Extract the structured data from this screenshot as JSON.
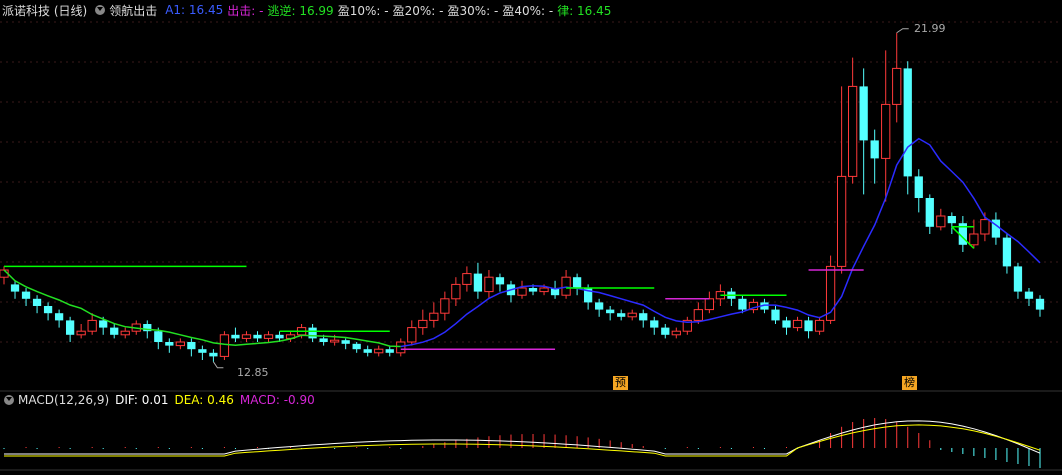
{
  "header": {
    "stock": "派诺科技 (日线)",
    "indicator": "领航出击",
    "a1": "A1: 16.45",
    "chuji": "出击: -",
    "taoni": "逃逆: 16.99",
    "y10": "盈10%: -",
    "y20": "盈20%: -",
    "y30": "盈30%: -",
    "y40": "盈40%: -",
    "lv": "律: 16.45"
  },
  "macd_header": {
    "name": "MACD(12,26,9)",
    "dif": "DIF: 0.01",
    "dea": "DEA: 0.46",
    "macd": "MACD: -0.90"
  },
  "price_labels": {
    "high": "21.99",
    "low": "12.85"
  },
  "tags": {
    "yu": "预",
    "bang": "榜"
  },
  "colors": {
    "up": "#ff3a3a",
    "down": "#54ffff",
    "bg": "#000000",
    "ma_green": "#22e022",
    "ma_blue": "#2b2bff",
    "magenta": "#d626d6",
    "dif": "#ffffff",
    "dea": "#ffff00",
    "bull": "#00ff00"
  },
  "chart_data": {
    "type": "candlestick",
    "high_marker": 21.99,
    "low_marker": 12.85,
    "candles": [
      [
        15.2,
        15.4,
        15.0,
        15.5
      ],
      [
        15.0,
        14.8,
        14.6,
        15.1
      ],
      [
        14.8,
        14.6,
        14.4,
        14.9
      ],
      [
        14.6,
        14.4,
        14.2,
        14.7
      ],
      [
        14.4,
        14.2,
        14.0,
        14.5
      ],
      [
        14.2,
        14.0,
        13.8,
        14.3
      ],
      [
        14.0,
        13.6,
        13.4,
        14.1
      ],
      [
        13.6,
        13.7,
        13.5,
        13.9
      ],
      [
        13.7,
        14.0,
        13.6,
        14.2
      ],
      [
        14.0,
        13.8,
        13.6,
        14.1
      ],
      [
        13.8,
        13.6,
        13.5,
        13.9
      ],
      [
        13.6,
        13.7,
        13.5,
        13.8
      ],
      [
        13.7,
        13.9,
        13.6,
        14.0
      ],
      [
        13.9,
        13.7,
        13.5,
        14.0
      ],
      [
        13.7,
        13.4,
        13.2,
        13.8
      ],
      [
        13.4,
        13.3,
        13.1,
        13.5
      ],
      [
        13.3,
        13.4,
        13.2,
        13.5
      ],
      [
        13.4,
        13.2,
        13.0,
        13.5
      ],
      [
        13.2,
        13.1,
        12.9,
        13.3
      ],
      [
        13.1,
        13.0,
        12.85,
        13.2
      ],
      [
        13.0,
        13.6,
        12.9,
        13.7
      ],
      [
        13.6,
        13.5,
        13.4,
        13.8
      ],
      [
        13.5,
        13.6,
        13.4,
        13.7
      ],
      [
        13.6,
        13.5,
        13.4,
        13.7
      ],
      [
        13.5,
        13.6,
        13.4,
        13.7
      ],
      [
        13.6,
        13.5,
        13.4,
        13.7
      ],
      [
        13.5,
        13.6,
        13.4,
        13.7
      ],
      [
        13.6,
        13.8,
        13.5,
        13.9
      ],
      [
        13.8,
        13.5,
        13.4,
        13.9
      ],
      [
        13.5,
        13.4,
        13.3,
        13.6
      ],
      [
        13.4,
        13.45,
        13.3,
        13.6
      ],
      [
        13.45,
        13.35,
        13.2,
        13.5
      ],
      [
        13.35,
        13.2,
        13.1,
        13.4
      ],
      [
        13.2,
        13.1,
        13.0,
        13.3
      ],
      [
        13.1,
        13.2,
        13.0,
        13.3
      ],
      [
        13.2,
        13.1,
        13.0,
        13.3
      ],
      [
        13.1,
        13.4,
        13.0,
        13.5
      ],
      [
        13.4,
        13.8,
        13.3,
        14.0
      ],
      [
        13.8,
        14.0,
        13.6,
        14.3
      ],
      [
        14.0,
        14.2,
        13.8,
        14.5
      ],
      [
        14.2,
        14.6,
        14.0,
        14.8
      ],
      [
        14.6,
        15.0,
        14.4,
        15.2
      ],
      [
        15.0,
        15.3,
        14.8,
        15.5
      ],
      [
        15.3,
        14.8,
        14.6,
        15.6
      ],
      [
        14.8,
        15.2,
        14.6,
        15.4
      ],
      [
        15.2,
        15.0,
        14.8,
        15.3
      ],
      [
        15.0,
        14.7,
        14.5,
        15.1
      ],
      [
        14.7,
        14.9,
        14.6,
        15.1
      ],
      [
        14.9,
        14.8,
        14.7,
        15.0
      ],
      [
        14.8,
        14.9,
        14.7,
        15.0
      ],
      [
        14.9,
        14.7,
        14.6,
        15.1
      ],
      [
        14.7,
        15.2,
        14.6,
        15.4
      ],
      [
        15.2,
        14.9,
        14.7,
        15.3
      ],
      [
        14.9,
        14.5,
        14.3,
        15.0
      ],
      [
        14.5,
        14.3,
        14.1,
        14.6
      ],
      [
        14.3,
        14.2,
        14.0,
        14.4
      ],
      [
        14.2,
        14.1,
        14.0,
        14.3
      ],
      [
        14.1,
        14.2,
        14.0,
        14.3
      ],
      [
        14.2,
        14.0,
        13.8,
        14.3
      ],
      [
        14.0,
        13.8,
        13.6,
        14.1
      ],
      [
        13.8,
        13.6,
        13.5,
        13.9
      ],
      [
        13.6,
        13.7,
        13.5,
        13.8
      ],
      [
        13.7,
        14.0,
        13.6,
        14.1
      ],
      [
        14.0,
        14.3,
        13.9,
        14.5
      ],
      [
        14.3,
        14.6,
        14.2,
        14.8
      ],
      [
        14.6,
        14.8,
        14.4,
        15.0
      ],
      [
        14.8,
        14.6,
        14.4,
        14.9
      ],
      [
        14.6,
        14.3,
        14.2,
        14.7
      ],
      [
        14.3,
        14.5,
        14.2,
        14.6
      ],
      [
        14.5,
        14.3,
        14.2,
        14.6
      ],
      [
        14.3,
        14.0,
        13.9,
        14.4
      ],
      [
        14.0,
        13.8,
        13.6,
        14.1
      ],
      [
        13.8,
        14.0,
        13.7,
        14.1
      ],
      [
        14.0,
        13.7,
        13.5,
        14.1
      ],
      [
        13.7,
        14.0,
        13.6,
        14.1
      ],
      [
        14.0,
        15.5,
        13.9,
        15.8
      ],
      [
        15.5,
        18.0,
        15.3,
        20.5
      ],
      [
        18.0,
        20.5,
        17.8,
        21.3
      ],
      [
        20.5,
        19.0,
        17.5,
        21.0
      ],
      [
        19.0,
        18.5,
        17.8,
        19.3
      ],
      [
        18.5,
        20.0,
        17.3,
        21.5
      ],
      [
        20.0,
        21.0,
        19.5,
        21.99
      ],
      [
        21.0,
        18.0,
        17.5,
        21.2
      ],
      [
        18.0,
        17.4,
        17.0,
        18.2
      ],
      [
        17.4,
        16.6,
        16.4,
        17.5
      ],
      [
        16.6,
        16.9,
        16.5,
        17.1
      ],
      [
        16.9,
        16.7,
        16.4,
        17.0
      ],
      [
        16.7,
        16.1,
        15.9,
        16.9
      ],
      [
        16.1,
        16.4,
        16.0,
        16.8
      ],
      [
        16.4,
        16.8,
        16.2,
        17.0
      ],
      [
        16.8,
        16.3,
        16.1,
        17.0
      ],
      [
        16.3,
        15.5,
        15.3,
        16.4
      ],
      [
        15.5,
        14.8,
        14.6,
        15.6
      ],
      [
        14.8,
        14.6,
        14.4,
        14.9
      ],
      [
        14.6,
        14.3,
        14.1,
        14.7
      ]
    ]
  }
}
